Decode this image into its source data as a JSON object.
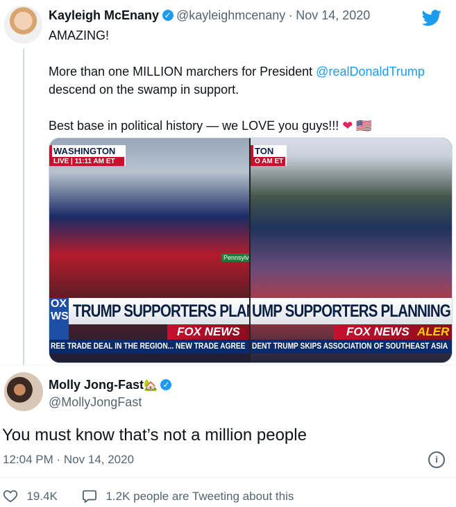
{
  "quoted_tweet": {
    "display_name": "Kayleigh McEnany",
    "handle": "@kayleighmcenany",
    "separator": "·",
    "date": "Nov 14, 2020",
    "line1": "AMAZING!",
    "line2_before": "More than one MILLION marchers for President ",
    "mention": "@realDonaldTrump",
    "line3": "descend on the swamp in support.",
    "line4": "Best base in political history — we LOVE you guys!!!",
    "emoji_heart": "❤",
    "emoji_flag": "🇺🇸",
    "media_left": {
      "location": "WASHINGTON",
      "live": "LIVE | 11:11 AM ET",
      "fox_box": "OX WS",
      "headline": "TRUMP SUPPORTERS PLANNING",
      "network": "FOX NEWS",
      "ticker": "REE TRADE DEAL IN THE REGION... NEW TRADE AGREE"
    },
    "media_right": {
      "location": "TON",
      "live": "O AM ET",
      "headline": "UMP SUPPORTERS PLANNING DC M",
      "network": "FOX NEWS",
      "network_alert": "ALER",
      "ticker": "DENT TRUMP SKIPS ASSOCIATION OF SOUTHEAST ASIA"
    }
  },
  "reply_tweet": {
    "display_name": "Molly Jong-Fast",
    "name_emoji": "🏡",
    "handle": "@MollyJongFast",
    "text": "You must know that’s not a million people",
    "time": "12:04 PM",
    "separator": "·",
    "date": "Nov 14, 2020"
  },
  "stats": {
    "likes": "19.4K",
    "replies_text": "1.2K people are Tweeting about this"
  },
  "icons": {
    "verified": "verified-badge-icon",
    "bird": "twitter-bird-icon",
    "info": "info-icon",
    "heart": "heart-outline-icon",
    "reply": "speech-bubble-icon"
  },
  "colors": {
    "brand_blue": "#1d9bf0",
    "muted": "#536471",
    "fox_red": "#c8102e",
    "fox_blue": "#0a2a6b"
  }
}
